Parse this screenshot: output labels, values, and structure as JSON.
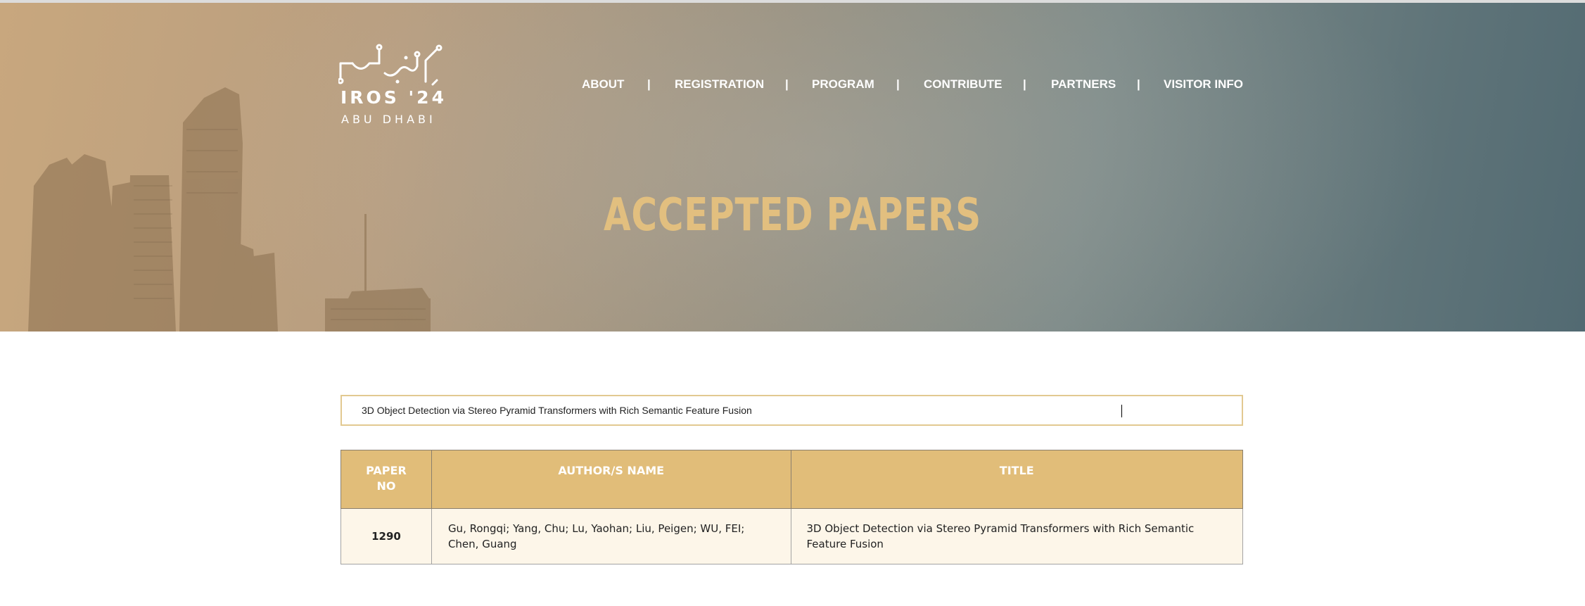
{
  "header": {
    "logo": {
      "arabic_mark": "ايروس",
      "title": "IROS '24",
      "subtitle": "ABU DHABI"
    },
    "nav": [
      {
        "label": "ABOUT"
      },
      {
        "label": "REGISTRATION"
      },
      {
        "label": "PROGRAM"
      },
      {
        "label": "CONTRIBUTE"
      },
      {
        "label": "PARTNERS"
      },
      {
        "label": "VISITOR INFO"
      }
    ],
    "nav_separator": "|",
    "page_title": "ACCEPTED PAPERS"
  },
  "search": {
    "value": "3D Object Detection via Stereo Pyramid Transformers with Rich Semantic Feature Fusion"
  },
  "table": {
    "columns": {
      "paper_no": "PAPER NO",
      "authors": "AUTHOR/S NAME",
      "title": "TITLE"
    },
    "rows": [
      {
        "paper_no": "1290",
        "authors": "Gu, Rongqi; Yang, Chu; Lu, Yaohan; Liu, Peigen; WU, FEI; Chen, Guang",
        "title": "3D Object Detection via Stereo Pyramid Transformers with Rich Semantic Feature Fusion"
      }
    ]
  },
  "colors": {
    "accent_gold": "#e1bd79",
    "title_gold": "#e2bf7f",
    "row_bg": "#fdf6e9",
    "search_border": "#e2c991"
  }
}
